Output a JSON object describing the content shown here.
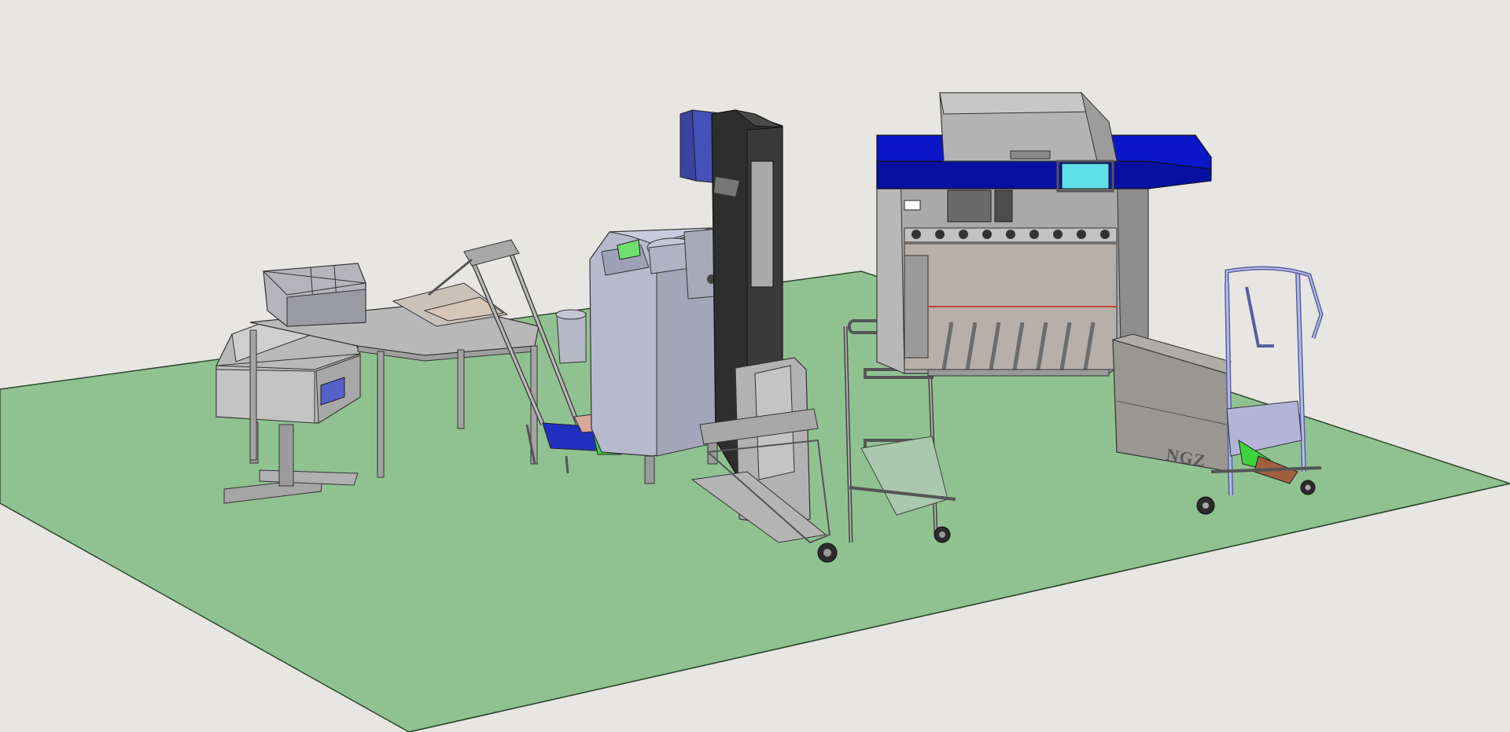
{
  "viewport": {
    "background_color": "#e8e6e2",
    "floor_color": "#90c291",
    "accent_blue": "#0a16c8",
    "screen_cyan": "#5fe0e8",
    "hmi_green": "#6fe06f"
  },
  "scene": {
    "machines": [
      {
        "name": "metal-detector-station",
        "icon": "metal-detector"
      },
      {
        "name": "packing-table-with-bins",
        "icon": "table"
      },
      {
        "name": "incline-conveyor",
        "icon": "conveyor"
      },
      {
        "name": "hopper-weigher",
        "icon": "weigher"
      },
      {
        "name": "vertical-elevator-column",
        "icon": "column"
      },
      {
        "name": "pallet-lift-trolley",
        "icon": "trolley"
      },
      {
        "name": "multi-lane-slicer",
        "icon": "slicer"
      },
      {
        "name": "tray-lift-trolley",
        "icon": "trolley"
      }
    ],
    "brand_label": "NGZ"
  }
}
